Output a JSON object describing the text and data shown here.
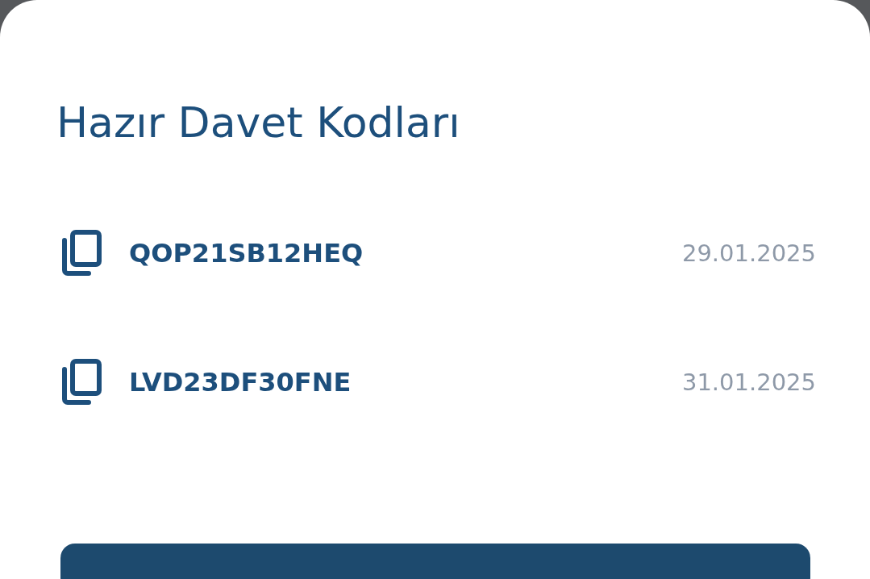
{
  "sheet": {
    "title": "Hazır Davet Kodları",
    "codes": [
      {
        "code": "QOP21SB12HEQ",
        "date": "29.01.2025"
      },
      {
        "code": "LVD23DF30FNE",
        "date": "31.01.2025"
      }
    ]
  }
}
